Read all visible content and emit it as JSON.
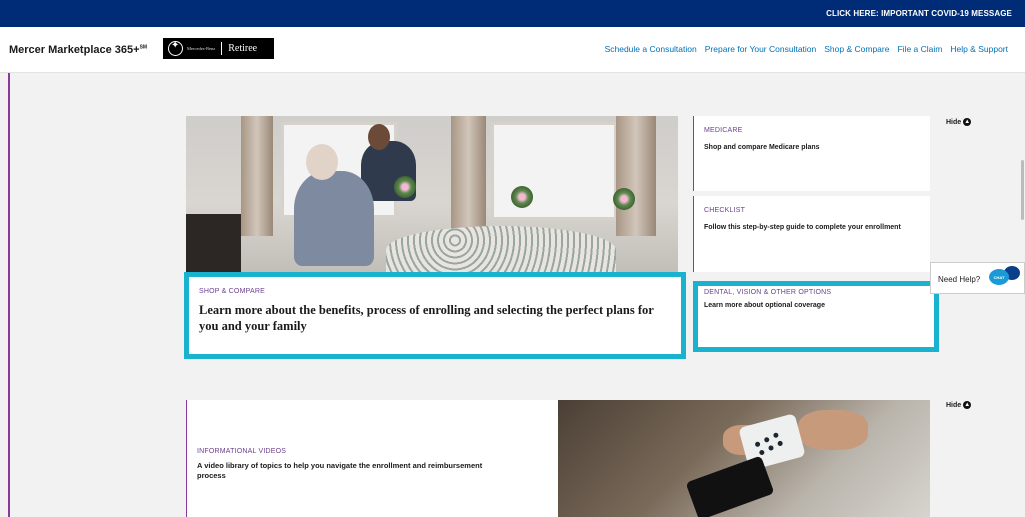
{
  "topbar": {
    "covid_label": "CLICK HERE:  IMPORTANT COVID-19 MESSAGE"
  },
  "header": {
    "brand": "Mercer Marketplace 365+",
    "brand_mark": "SM",
    "logo_small_text": "Mercedes-Benz",
    "logo_text": "Retiree",
    "nav": [
      "Schedule a Consultation",
      "Prepare for Your Consultation",
      "Shop & Compare",
      "File a Claim",
      "Help & Support"
    ]
  },
  "main_card": {
    "eyebrow": "SHOP & COMPARE",
    "title": "Learn more about the benefits, process of enrolling and selecting the perfect plans for you and your family"
  },
  "side_cards": [
    {
      "eyebrow": "MEDICARE",
      "desc": "Shop and compare Medicare plans"
    },
    {
      "eyebrow": "CHECKLIST",
      "desc": "Follow this step-by-step guide to complete your enrollment"
    },
    {
      "eyebrow": "DENTAL, VISION & OTHER OPTIONS",
      "desc": "Learn more about optional coverage"
    }
  ],
  "hide_label": "Hide",
  "need_help": {
    "label": "Need Help?",
    "chat": "CHAT"
  },
  "video_card": {
    "eyebrow": "INFORMATIONAL VIDEOS",
    "desc": "A video library of topics to help you navigate the enrollment and reimbursement process"
  },
  "colors": {
    "navy": "#002c77",
    "link": "#0071b9",
    "highlight": "#19b3cf",
    "accent": "#8a3a9b"
  }
}
